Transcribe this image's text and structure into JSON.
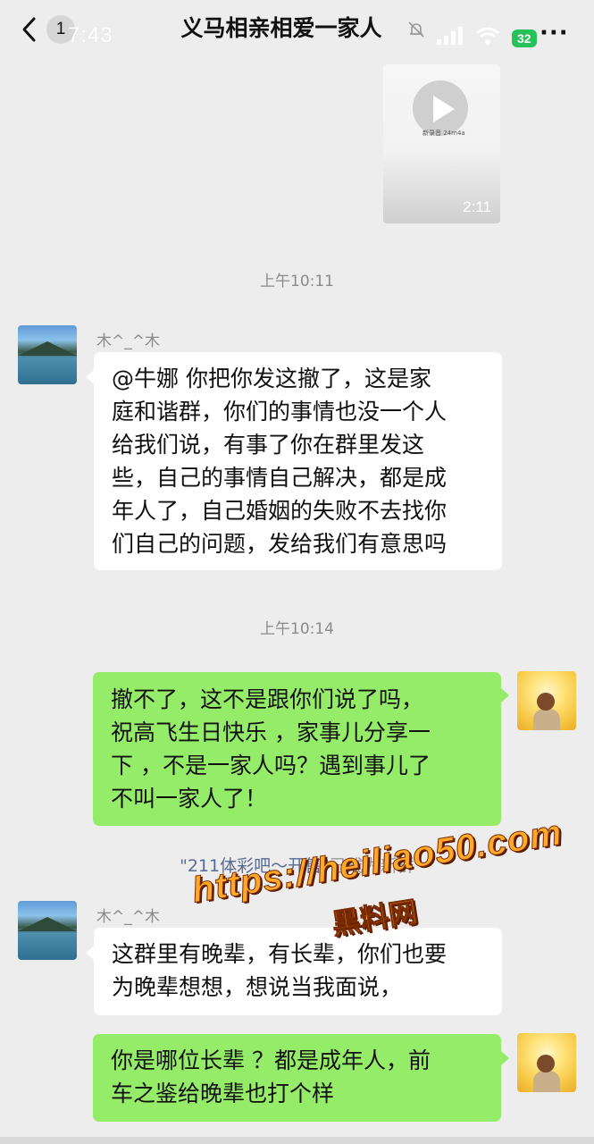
{
  "header": {
    "back_count": "1",
    "clock": "7:43",
    "title": "义马相亲相爱一家人",
    "battery": "32"
  },
  "video_message": {
    "caption": "新录音 24m4a",
    "duration": "2:11"
  },
  "timestamps": [
    "上午10:11",
    "上午10:14"
  ],
  "messages": [
    {
      "sender": "木^_^木",
      "lines": [
        "@牛娜  你把你发这撤了，这是家",
        "庭和谐群，你们的事情也没一个人",
        "给我们说，有事了你在群里发这",
        "些，自己的事情自己解决，都是成",
        "年人了，自己婚姻的失败不去找你",
        "们自己的问题，发给我们有意思吗"
      ]
    },
    {
      "sender": "",
      "lines": [
        "撤不了，这不是跟你们说了吗，",
        "祝高飞生日快乐 ，家事儿分享一",
        "下 ，不是一家人吗？遇到事儿了",
        "不叫一家人了！"
      ]
    },
    {
      "sender": "木^_^木",
      "lines": [
        "这群里有晚辈，有长辈，你们也要",
        "为晚辈想想，想说当我面说，"
      ]
    },
    {
      "sender": "",
      "lines": [
        "你是哪位长辈 ？都是成年人，前",
        "车之鉴给晚辈也打个样"
      ]
    }
  ],
  "system_notice": {
    "link_text": "\"211体彩吧～开售\"",
    "rest_text": "已成为新群"
  },
  "watermark": {
    "url": "https://heiliao50.com",
    "name": "黑料网"
  },
  "colors": {
    "background": "#ededed",
    "green_bubble": "#95ec69",
    "white_bubble": "#ffffff",
    "timestamp": "#8a8a8a",
    "link": "#576b95",
    "watermark": "#ffa92a"
  }
}
